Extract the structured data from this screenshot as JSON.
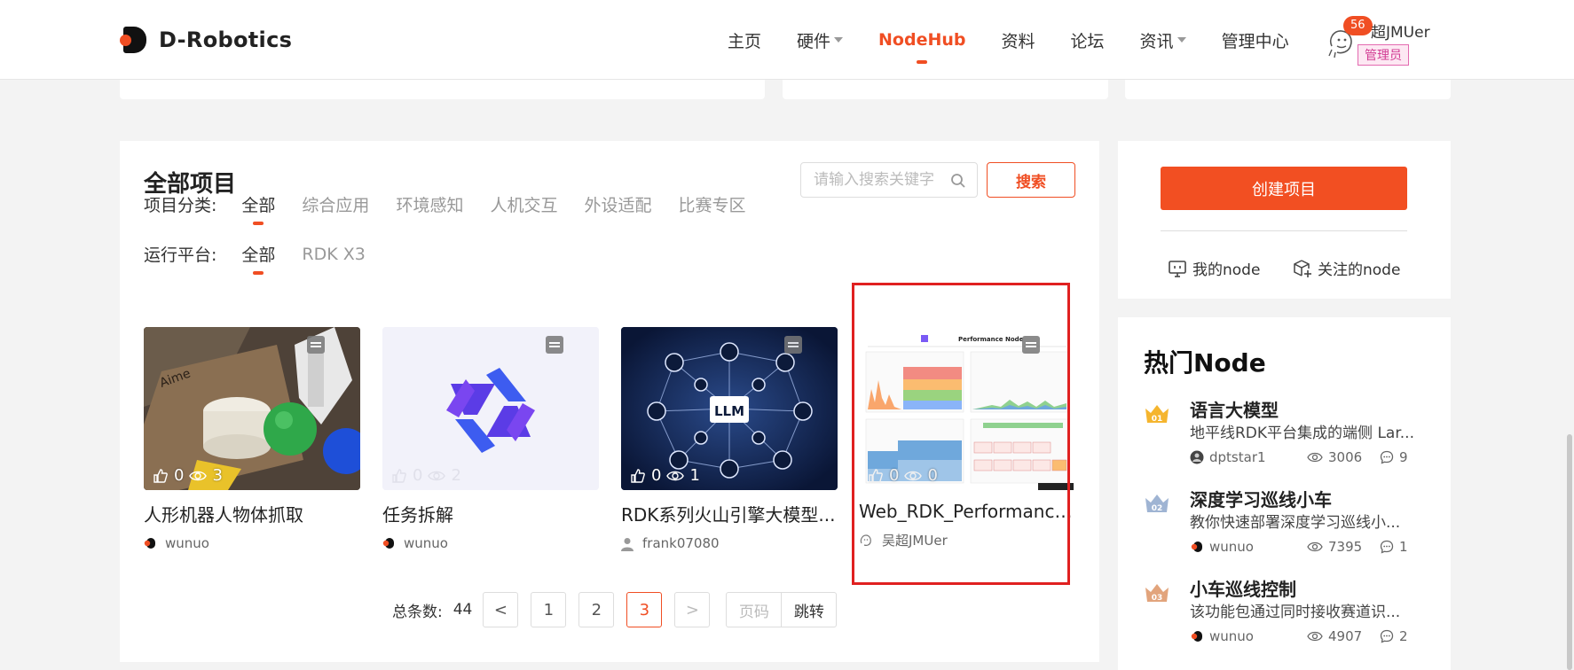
{
  "header": {
    "logo_text": "D-Robotics",
    "nav": [
      {
        "label": "主页",
        "caret": false,
        "active": false
      },
      {
        "label": "硬件",
        "caret": true,
        "active": false
      },
      {
        "label": "NodeHub",
        "caret": false,
        "active": true
      },
      {
        "label": "资料",
        "caret": false,
        "active": false
      },
      {
        "label": "论坛",
        "caret": false,
        "active": false
      },
      {
        "label": "资讯",
        "caret": true,
        "active": false
      },
      {
        "label": "管理中心",
        "caret": false,
        "active": false
      }
    ],
    "user": {
      "badge_count": "56",
      "name": "超JMUer",
      "role": "管理员"
    }
  },
  "main": {
    "title": "全部项目",
    "search": {
      "placeholder": "请输入搜索关键字",
      "button_label": "搜索"
    },
    "category_filter": {
      "label": "项目分类:",
      "options": [
        "全部",
        "综合应用",
        "环境感知",
        "人机交互",
        "外设适配",
        "比赛专区"
      ],
      "active_index": 0
    },
    "platform_filter": {
      "label": "运行平台:",
      "options": [
        "全部",
        "RDK X3"
      ],
      "active_index": 0
    },
    "projects": [
      {
        "title": "人形机器人物体抓取",
        "likes": "0",
        "views": "3",
        "author": "wunuo",
        "thumb": "photo"
      },
      {
        "title": "任务拆解",
        "likes": "0",
        "views": "2",
        "author": "wunuo",
        "thumb": "star-logo"
      },
      {
        "title": "RDK系列火山引擎大模型...",
        "likes": "0",
        "views": "1",
        "author": "frank07080",
        "thumb": "llm-network"
      },
      {
        "title": "Web_RDK_Performance_N...",
        "likes": "0",
        "views": "0",
        "author": "吴超JMUer",
        "thumb": "performance-dashboard",
        "thumb_heading": "Performance Node"
      }
    ],
    "pagination": {
      "total_label": "总条数:",
      "total": "44",
      "prev": "<",
      "pages": [
        "1",
        "2",
        "3"
      ],
      "current": "3",
      "next": ">",
      "page_input_placeholder": "页码",
      "jump_label": "跳转"
    }
  },
  "sidebar": {
    "create_button": "创建项目",
    "my_node_label": "我的node",
    "followed_node_label": "关注的node",
    "hot_title": "热门Node",
    "hot_items": [
      {
        "rank": "01",
        "name": "语言大模型",
        "desc": "地平线RDK平台集成的端侧 Lar...",
        "author": "dptstar1",
        "views": "3006",
        "comments": "9",
        "rank_color": "#f5b52e"
      },
      {
        "rank": "02",
        "name": "深度学习巡线小车",
        "desc": "教你快速部署深度学习巡线小...",
        "author": "wunuo",
        "views": "7395",
        "comments": "1",
        "rank_color": "#9fb4d3"
      },
      {
        "rank": "03",
        "name": "小车巡线控制",
        "desc": "该功能包通过同时接收赛道识...",
        "author": "wunuo",
        "views": "4907",
        "comments": "2",
        "rank_color": "#e2a47c"
      }
    ]
  },
  "colors": {
    "accent": "#f04e23",
    "highlight_frame": "#e02020"
  }
}
